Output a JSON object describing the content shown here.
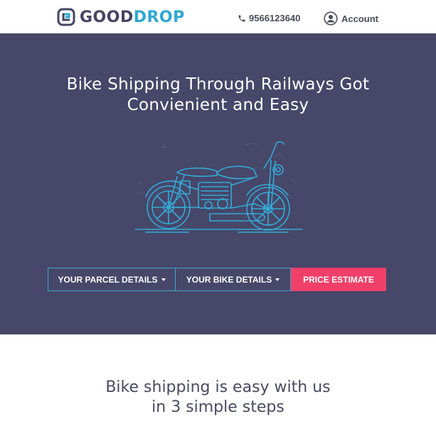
{
  "header": {
    "logo": {
      "part1": "GOOD",
      "part2": "DROP"
    },
    "phone": {
      "icon": "phone-icon",
      "number": "9566123640"
    },
    "account": {
      "icon": "user-circle-icon",
      "label": "Account"
    }
  },
  "hero": {
    "title_line1": "Bike Shipping Through Railways Got",
    "title_line2": "Convienient and Easy",
    "illustration": "motorcycle-line-illustration",
    "buttons": {
      "parcel_label": "YOUR PARCEL DETAILS",
      "bike_label": "YOUR BIKE DETAILS",
      "price_label": "PRICE ESTIMATE"
    }
  },
  "steps": {
    "heading_line1": "Bike shipping is easy with us",
    "heading_line2": "in 3 simple steps"
  },
  "colors": {
    "hero_bg": "#464769",
    "accent_blue": "#2fa7d1",
    "price_button": "#f0406a",
    "logo_dark": "#444463"
  }
}
